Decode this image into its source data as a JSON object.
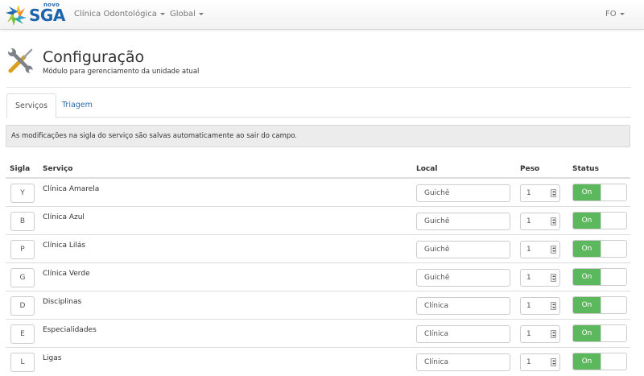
{
  "navbar": {
    "brand_small": "novo",
    "brand_big": "SGA",
    "unit_menu": "Clínica Odontológica",
    "global_menu": "Global",
    "user_menu": "FO"
  },
  "header": {
    "title": "Configuração",
    "subtitle": "Módulo para gerenciamento da unidade atual"
  },
  "tabs": [
    {
      "label": "Serviços",
      "active": true
    },
    {
      "label": "Triagem",
      "active": false
    }
  ],
  "alert": "As modificações na sigla do serviço são salvas automaticamente ao sair do campo.",
  "table": {
    "columns": [
      "Sigla",
      "Serviço",
      "Local",
      "Peso",
      "Status"
    ],
    "rows": [
      {
        "sigla": "Y",
        "servico": "Clínica Amarela",
        "local": "Guichê",
        "peso": "1",
        "status": "On"
      },
      {
        "sigla": "B",
        "servico": "Clínica Azul",
        "local": "Guichê",
        "peso": "1",
        "status": "On"
      },
      {
        "sigla": "P",
        "servico": "Clínica Lilás",
        "local": "Guichê",
        "peso": "1",
        "status": "On"
      },
      {
        "sigla": "G",
        "servico": "Clínica Verde",
        "local": "Guichê",
        "peso": "1",
        "status": "On"
      },
      {
        "sigla": "D",
        "servico": "Disciplinas",
        "local": "Clínica",
        "peso": "1",
        "status": "On"
      },
      {
        "sigla": "E",
        "servico": "Especialidades",
        "local": "Clínica",
        "peso": "1",
        "status": "On"
      },
      {
        "sigla": "L",
        "servico": "Ligas",
        "local": "Clínica",
        "peso": "1",
        "status": "On"
      }
    ]
  },
  "colors": {
    "brand": "#1e64ac",
    "link": "#2a6aa8",
    "toggle_on": "#5cb85c"
  },
  "icons": {
    "logo": "sunburst-logo-icon",
    "page": "wrench-screwdriver-icon",
    "caret": "caret-down-icon",
    "spinner": "number-spinner-icon"
  }
}
